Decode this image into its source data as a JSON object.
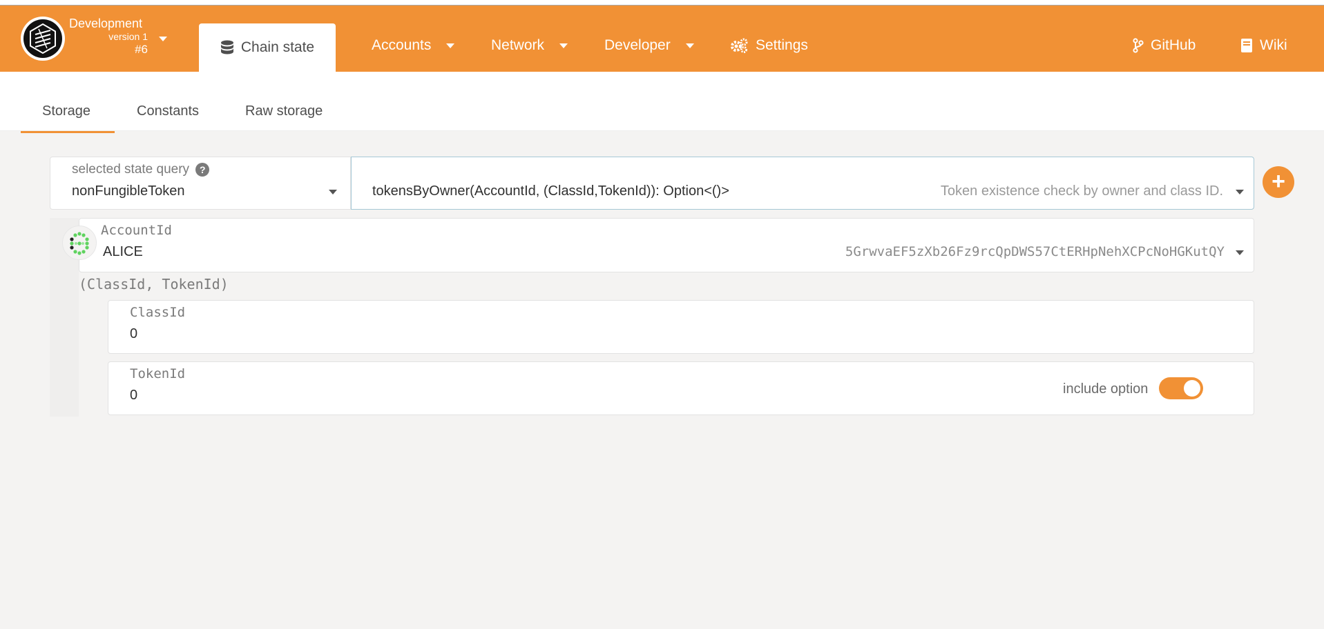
{
  "chain": {
    "name": "Development",
    "version": "version 1",
    "block": "#6"
  },
  "nav": {
    "chain_state": "Chain state",
    "accounts": "Accounts",
    "network": "Network",
    "developer": "Developer",
    "settings": "Settings",
    "github": "GitHub",
    "wiki": "Wiki"
  },
  "subnav": {
    "storage": "Storage",
    "constants": "Constants",
    "raw_storage": "Raw storage"
  },
  "query": {
    "label": "selected state query",
    "module": "nonFungibleToken",
    "method": "tokensByOwner(AccountId, (ClassId,TokenId)): Option<()>",
    "description": "Token existence check by owner and class ID."
  },
  "params": {
    "account": {
      "label": "AccountId",
      "name": "ALICE",
      "address": "5GrwvaEF5zXb26Fz9rcQpDWS57CtERHpNehXCPcNoHGKutQY"
    },
    "tuple_label": "(ClassId, TokenId)",
    "class_id": {
      "label": "ClassId",
      "value": "0"
    },
    "token_id": {
      "label": "TokenId",
      "value": "0"
    },
    "include_option_label": "include option",
    "include_option_on": true
  },
  "colors": {
    "accent": "#f19135",
    "background": "#f4f3f2"
  }
}
